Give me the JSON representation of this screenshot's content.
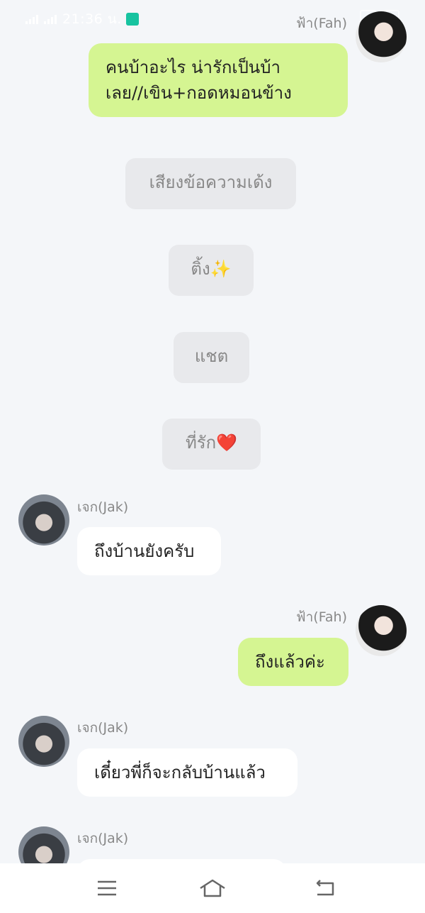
{
  "status": {
    "time": "21:36 น."
  },
  "messages": [
    {
      "id": "m1",
      "from": "fah",
      "name": "ฟ้า(Fah)",
      "text_lines": [
        "คนบ้าอะไร น่ารักเป็นบ้า",
        "เลย//เขิน+กอดหมอนข้าง"
      ]
    },
    {
      "id": "s1",
      "from": "system",
      "text": "เสียงข้อความเด้ง"
    },
    {
      "id": "s2",
      "from": "system",
      "text": "ติ้ง✨"
    },
    {
      "id": "s3",
      "from": "system",
      "text": "แชต"
    },
    {
      "id": "s4",
      "from": "system",
      "text": "ที่รัก❤️"
    },
    {
      "id": "m2",
      "from": "jak",
      "name": "เจก(Jak)",
      "text": "ถึงบ้านยังครับ"
    },
    {
      "id": "m3",
      "from": "fah",
      "name": "ฟ้า(Fah)",
      "text": "ถึงแล้วค่ะ"
    },
    {
      "id": "m4",
      "from": "jak",
      "name": "เจก(Jak)",
      "text": "เดี๋ยวพี่ก็จะกลับบ้านแล้ว"
    },
    {
      "id": "m5",
      "from": "jak",
      "name": "เจก(Jak)",
      "text": ""
    }
  ],
  "nav": {
    "icons": [
      "menu-icon",
      "home-icon",
      "back-icon"
    ]
  },
  "colors": {
    "background": "#f4f6f9",
    "my_bubble": "#d5f592",
    "their_bubble": "#ffffff",
    "system_bubble": "#e8e9ec"
  }
}
